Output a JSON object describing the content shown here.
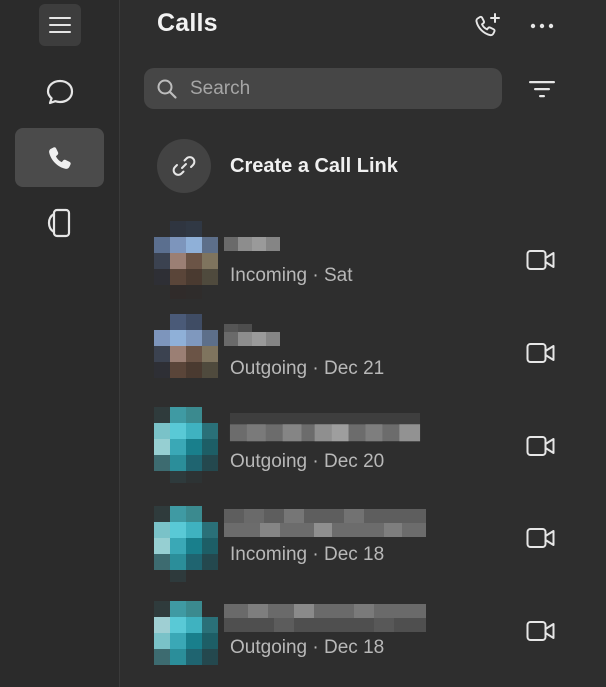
{
  "header": {
    "title": "Calls"
  },
  "search": {
    "placeholder": "Search"
  },
  "create_link": {
    "label": "Create a Call Link"
  },
  "calls": [
    {
      "subtitle": "Incoming · Sat"
    },
    {
      "subtitle": "Outgoing · Dec 21"
    },
    {
      "subtitle": "Outgoing · Dec 20"
    },
    {
      "subtitle": "Incoming · Dec 18"
    },
    {
      "subtitle": "Outgoing · Dec 18"
    }
  ],
  "icons": {
    "menu": "hamburger-menu-icon",
    "chat": "chat-bubble-icon",
    "calls": "phone-icon",
    "device": "device-icon",
    "add_call": "phone-plus-icon",
    "more": "more-dots-icon",
    "search": "search-icon",
    "filter": "filter-icon",
    "link": "link-icon",
    "video": "video-camera-icon"
  },
  "colors": {
    "background": "#2e2e2e",
    "rail": "#2b2b2b",
    "selected": "#4b4b4b",
    "text": "#f2f2f2",
    "muted": "#b8b8b8"
  }
}
